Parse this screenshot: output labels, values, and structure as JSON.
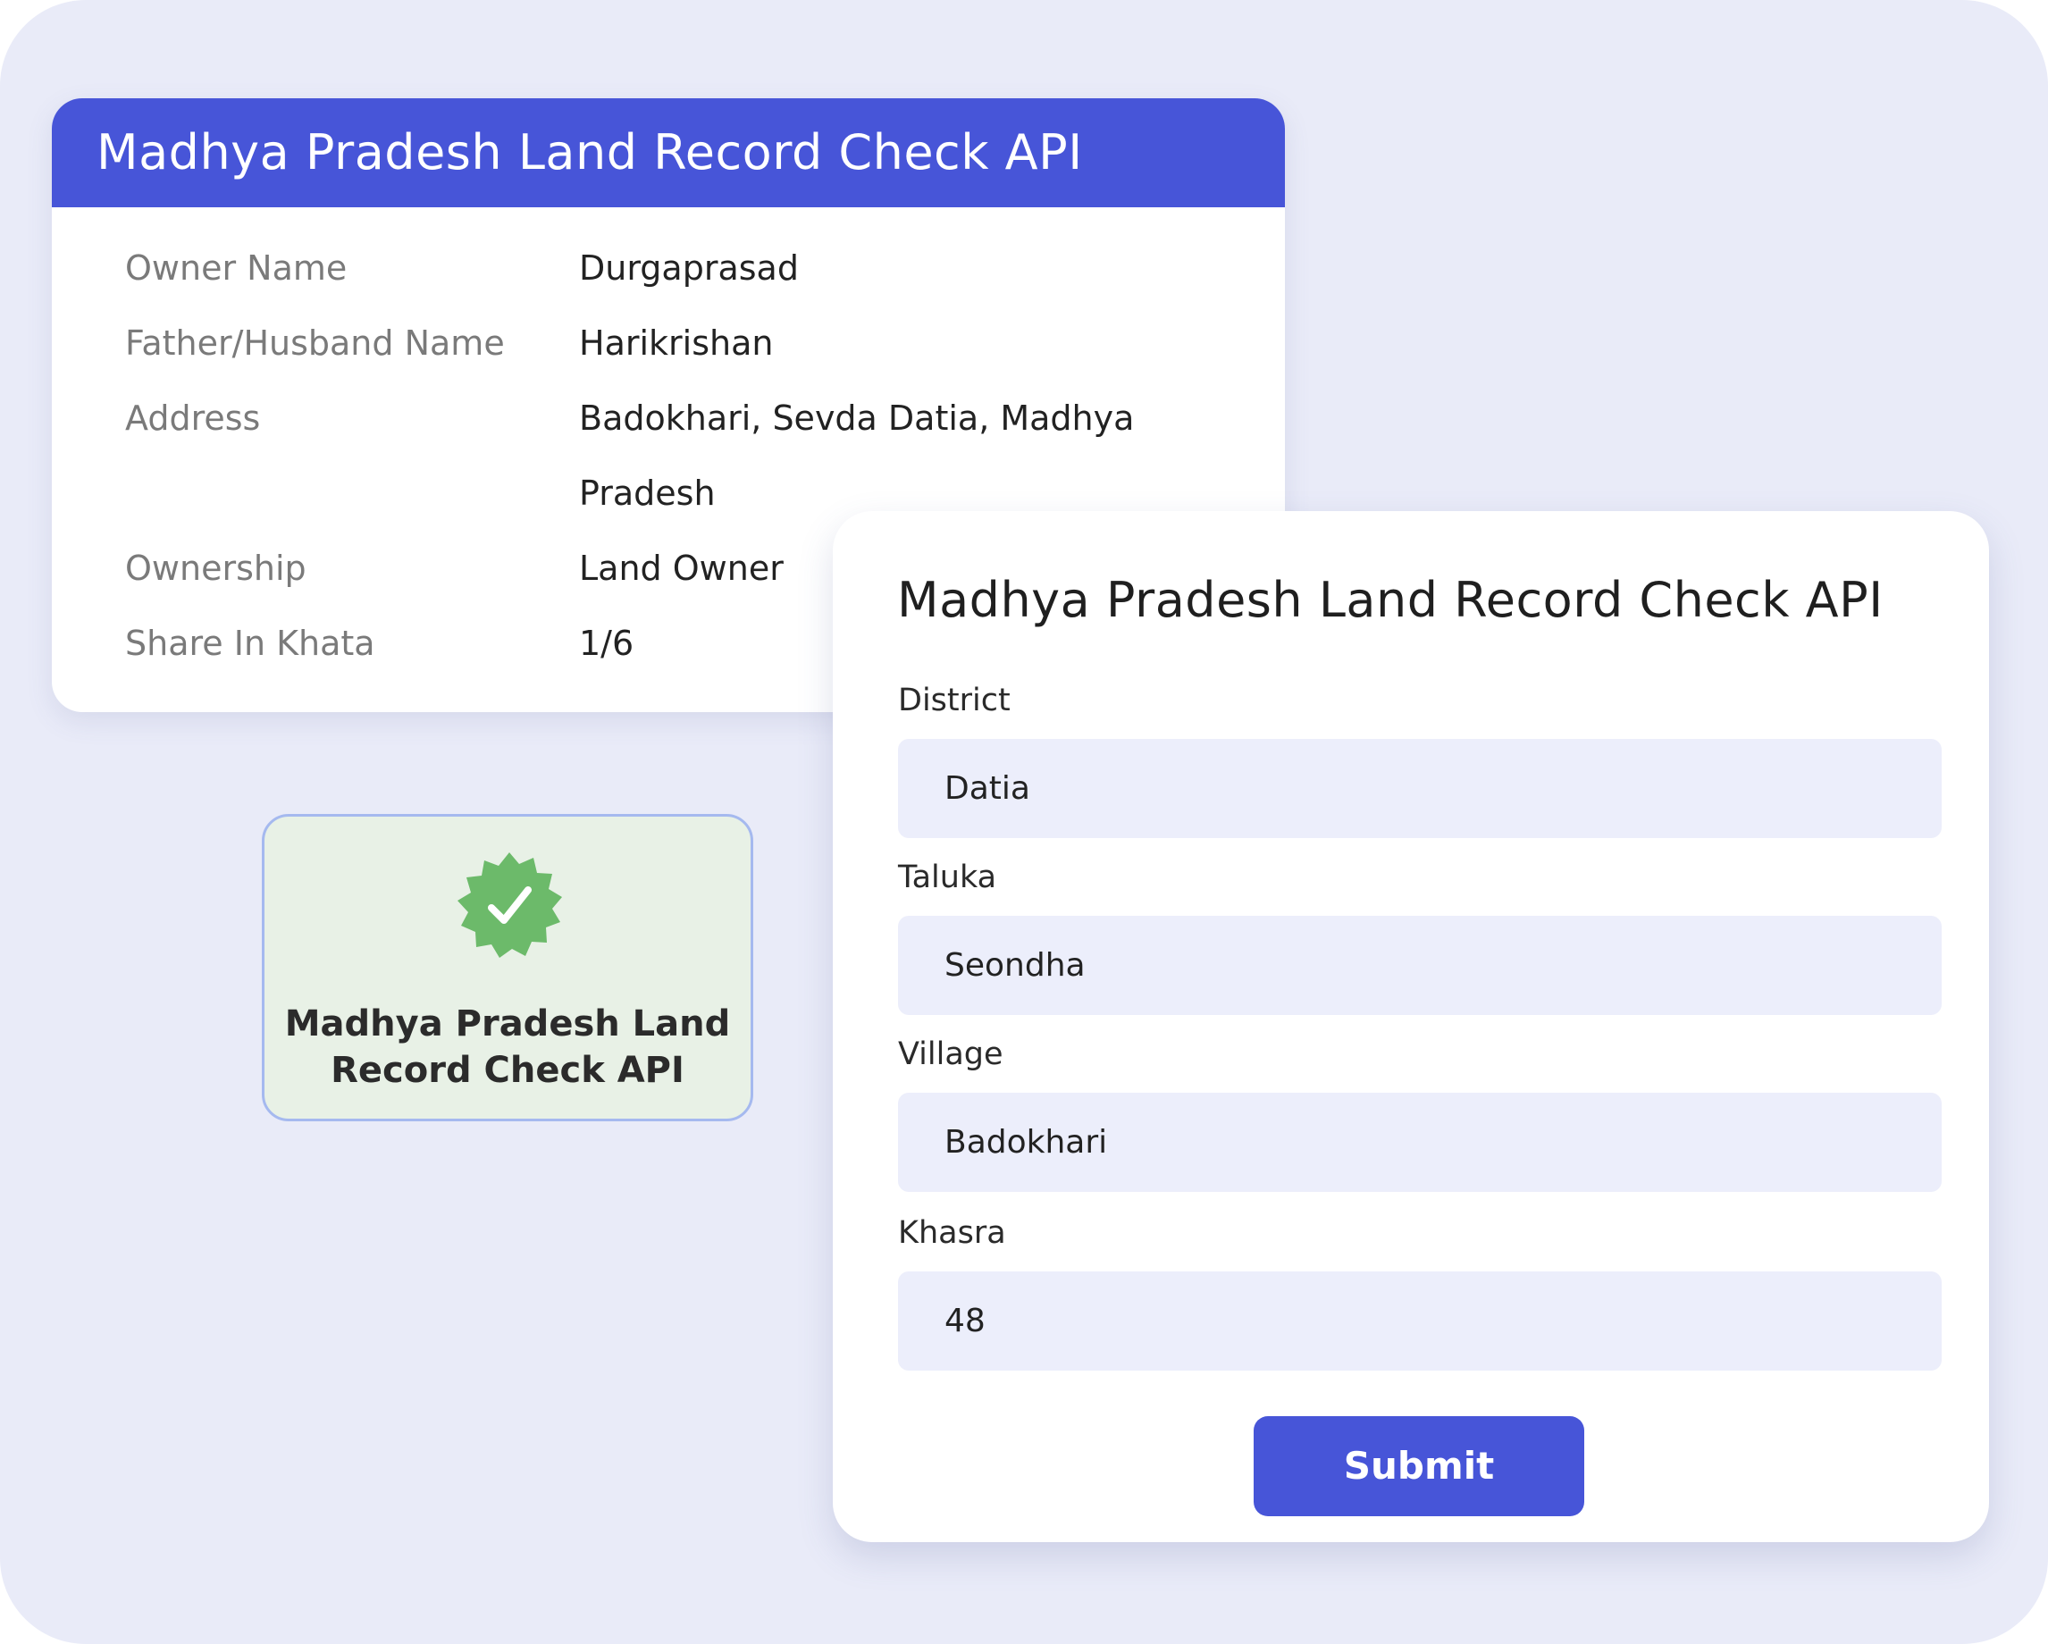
{
  "colors": {
    "background": "#e9ebf8",
    "accent": "#4755d8",
    "badge_green": "#6cba6a",
    "badge_bg": "#e8f1e6",
    "input_bg": "#eceefb"
  },
  "result_card": {
    "title": "Madhya Pradesh Land Record Check API",
    "rows": [
      {
        "label": "Owner Name",
        "value": "Durgaprasad"
      },
      {
        "label": "Father/Husband Name",
        "value": "Harikrishan"
      },
      {
        "label": "Address",
        "value": "Badokhari, Sevda Datia, Madhya Pradesh"
      },
      {
        "label": "Ownership",
        "value": "Land Owner"
      },
      {
        "label": "Share In Khata",
        "value": "1/6"
      }
    ]
  },
  "badge": {
    "icon": "verified-check-badge-icon",
    "text": "Madhya Pradesh Land Record Check API"
  },
  "form": {
    "title": "Madhya Pradesh Land Record Check API",
    "fields": [
      {
        "label": "District",
        "value": "Datia"
      },
      {
        "label": "Taluka",
        "value": "Seondha"
      },
      {
        "label": "Village",
        "value": "Badokhari"
      },
      {
        "label": "Khasra",
        "value": "48"
      }
    ],
    "submit_label": "Submit"
  }
}
